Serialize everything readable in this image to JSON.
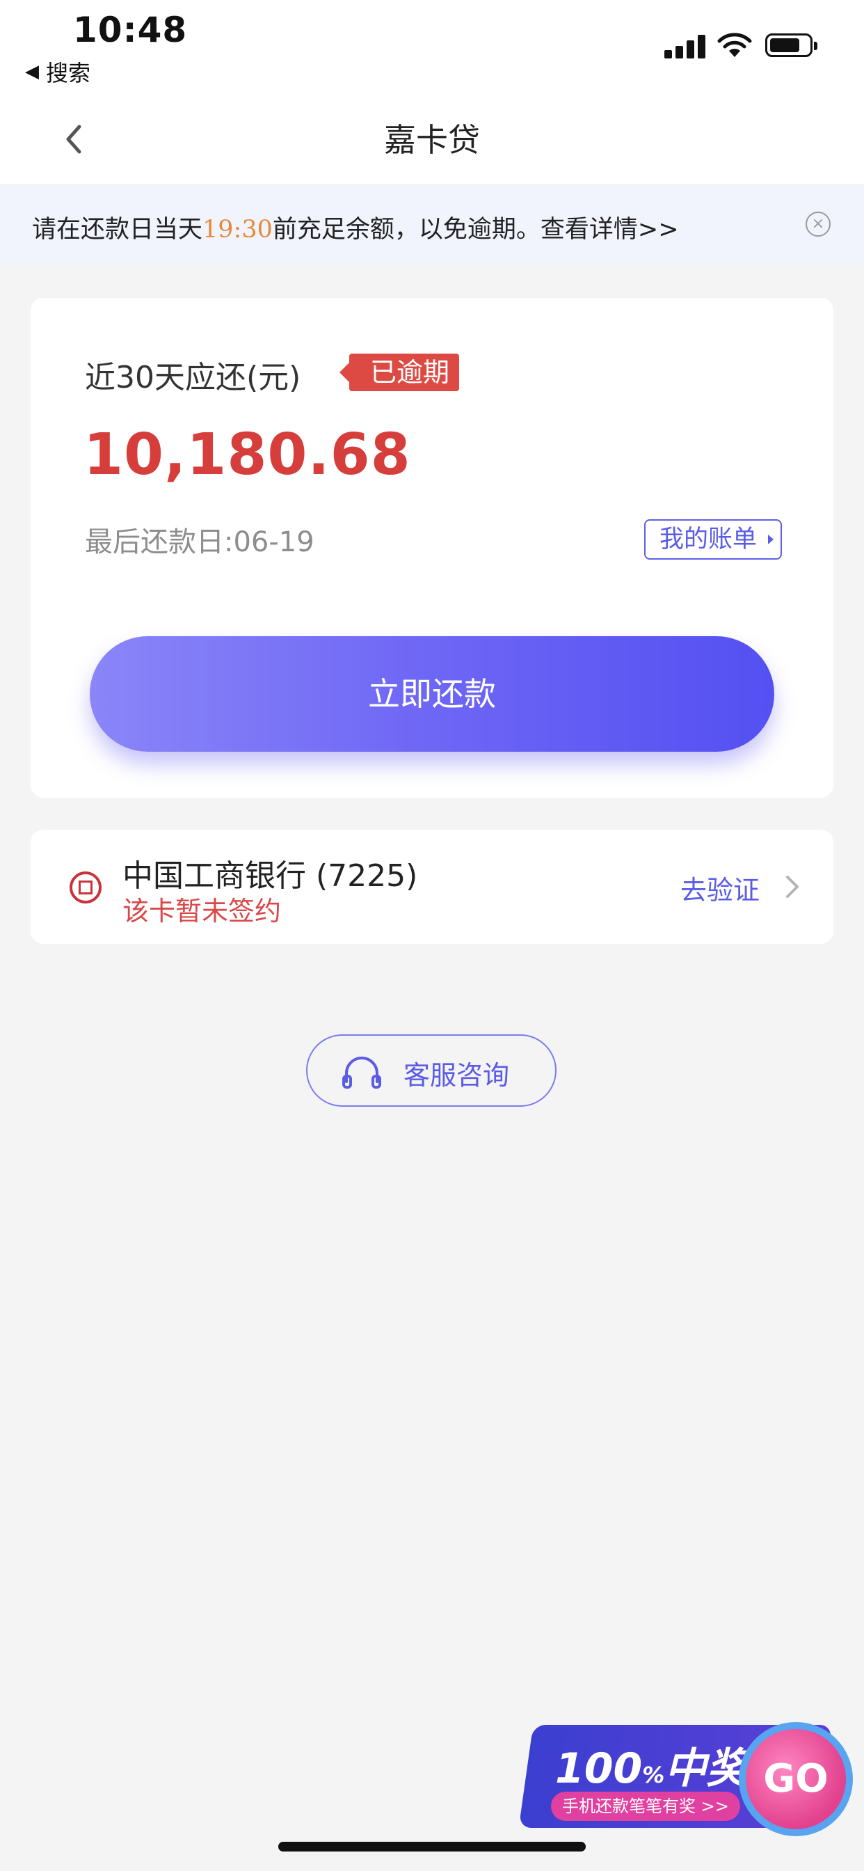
{
  "status_bar": {
    "time": "10:48",
    "back_app": "搜索",
    "back_icon": "back-triangle-icon"
  },
  "nav": {
    "title": "嘉卡贷",
    "back_icon": "chevron-left-icon"
  },
  "notice": {
    "text_before": "请在还款日当天",
    "highlight_time": "19:30",
    "text_after": "前充足余额，以免逾期。查看详情>>",
    "highlight_color": "#e58a3a",
    "close_symbol": "×"
  },
  "repayment": {
    "label": "近30天应还(元)",
    "badge": "已逾期",
    "amount": "10,180.68",
    "due_date": "最后还款日:06-19",
    "bill_link": "我的账单",
    "pay_button": "立即还款"
  },
  "bank": {
    "name": "中国工商银行 (7225)",
    "status": "该卡暂未签约",
    "action": "去验证"
  },
  "service": {
    "label": "客服咨询",
    "icon": "headset-icon"
  },
  "promo": {
    "headline_number": "100",
    "headline_pct": "%",
    "headline_text": "中奖",
    "subtitle": "手机还款笔笔有奖 >>",
    "go": "GO"
  },
  "colors": {
    "accent": "#5a5ce6",
    "danger": "#d63e3c",
    "badge": "#dd4a44",
    "background": "#f4f4f5"
  }
}
